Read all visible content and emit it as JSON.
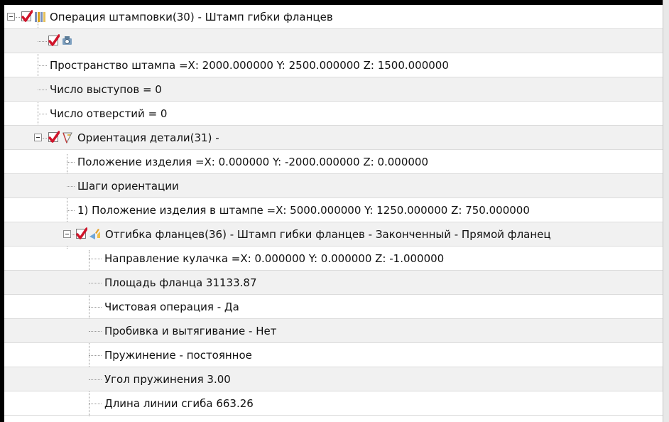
{
  "tree": {
    "root": {
      "label": "Операция штамповки(30) - Штамп гибки фланцев"
    },
    "die_space": "Пространство штампа =X: 2000.000000 Y: 2500.000000 Z: 1500.000000",
    "protrusions": "Число выступов = 0",
    "holes": "Число отверстий = 0",
    "orientation": {
      "label": "Ориентация детали(31) -",
      "part_position": "Положение изделия =X: 0.000000 Y: -2000.000000 Z: 0.000000",
      "steps": "Шаги ориентации",
      "step_1": "1) Положение изделия в штампе =X: 5000.000000 Y: 1250.000000 Z: 750.000000",
      "flange_bend": {
        "label": "Отгибка фланцев(36) - Штамп гибки фланцев - Законченный - Прямой фланец",
        "cam_direction": "Направление кулачка =X: 0.000000 Y: 0.000000 Z: -1.000000",
        "flange_area": "Площадь фланца 31133.87",
        "finishing": "Чистовая операция - Да",
        "piercing": "Пробивка и вытягивание - Нет",
        "springback": "Пружинение - постоянное",
        "springback_angle": "Угол пружинения 3.00",
        "bend_line_length": "Длина линии сгиба 663.26"
      }
    }
  },
  "colors": {
    "check_mark": "#d0142a",
    "alt_row": "#f1f1f1",
    "tree_line": "#9a9a9a"
  }
}
